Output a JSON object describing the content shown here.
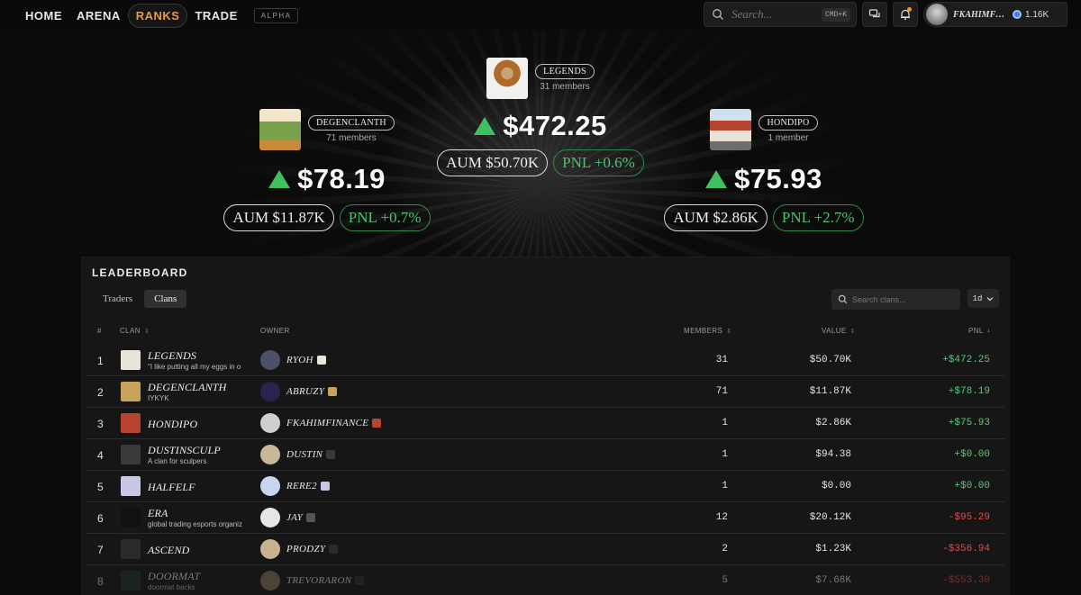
{
  "nav": {
    "links": [
      "HOME",
      "ARENA",
      "RANKS",
      "TRADE"
    ],
    "active": "RANKS",
    "badge": "ALPHA",
    "search_placeholder": "Search...",
    "shortcut": "CMD+K",
    "user_name": "FKAHIMFIN...",
    "balance": "1.16K",
    "icons": [
      "search-icon",
      "chat-icon",
      "bell-icon"
    ],
    "notification_color": "#e8993a"
  },
  "podium": {
    "first": {
      "clan": "LEGENDS",
      "members": "31 members",
      "pnl": "$472.25",
      "aum": "AUM $50.70K",
      "pnl_pct": "PNL +0.6%"
    },
    "second": {
      "clan": "DEGENCLANTH",
      "members": "71 members",
      "pnl": "$78.19",
      "aum": "AUM $11.87K",
      "pnl_pct": "PNL +0.7%"
    },
    "third": {
      "clan": "HONDIPO",
      "members": "1 member",
      "pnl": "$75.93",
      "aum": "AUM $2.86K",
      "pnl_pct": "PNL +2.7%"
    },
    "up_color": "#3ec25e"
  },
  "leaderboard": {
    "title": "LEADERBOARD",
    "tabs": [
      "Traders",
      "Clans"
    ],
    "active_tab": "Clans",
    "search_placeholder": "Search clans...",
    "period": "1d",
    "columns": {
      "rank": "#",
      "clan": "CLAN",
      "owner": "OWNER",
      "members": "MEMBERS",
      "value": "VALUE",
      "pnl": "PNL"
    },
    "rows": [
      {
        "rank": "1",
        "clan": "LEGENDS",
        "desc": "\"I like putting all my eggs in o",
        "owner": "RYOH",
        "members": "31",
        "value": "$50.70K",
        "pnl": "+$472.25",
        "dir": "pos"
      },
      {
        "rank": "2",
        "clan": "DEGENCLANTH",
        "desc": "IYKYK",
        "owner": "ABRUZY",
        "members": "71",
        "value": "$11.87K",
        "pnl": "+$78.19",
        "dir": "pos"
      },
      {
        "rank": "3",
        "clan": "HONDIPO",
        "desc": "",
        "owner": "FKAHIMFINANCE",
        "members": "1",
        "value": "$2.86K",
        "pnl": "+$75.93",
        "dir": "pos"
      },
      {
        "rank": "4",
        "clan": "DUSTINSCULP",
        "desc": "A clan for sculpers",
        "owner": "DUSTIN",
        "members": "1",
        "value": "$94.38",
        "pnl": "+$0.00",
        "dir": "pos"
      },
      {
        "rank": "5",
        "clan": "HALFELF",
        "desc": "",
        "owner": "RERE2",
        "members": "1",
        "value": "$0.00",
        "pnl": "+$0.00",
        "dir": "pos"
      },
      {
        "rank": "6",
        "clan": "ERA",
        "desc": "global trading esports organiz",
        "owner": "JAY",
        "members": "12",
        "value": "$20.12K",
        "pnl": "-$95.29",
        "dir": "neg"
      },
      {
        "rank": "7",
        "clan": "ASCEND",
        "desc": "",
        "owner": "PRODZY",
        "members": "2",
        "value": "$1.23K",
        "pnl": "-$356.94",
        "dir": "neg"
      },
      {
        "rank": "8",
        "clan": "DOORMAT",
        "desc": "doormat backs",
        "owner": "TREVORARON",
        "members": "5",
        "value": "$7.68K",
        "pnl": "-$553.30",
        "dir": "neg"
      }
    ]
  }
}
